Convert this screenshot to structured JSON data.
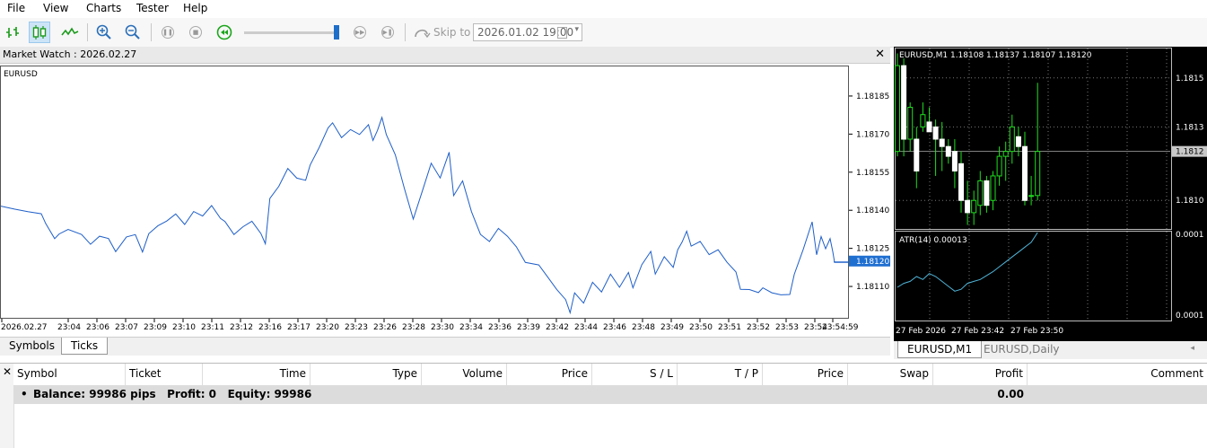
{
  "menu": [
    "File",
    "View",
    "Charts",
    "Tester",
    "Help"
  ],
  "toolbar": {
    "skip_label": "Skip to",
    "skip_date": "2026.01.02 19:00",
    "speed_fraction": 0.95
  },
  "market_watch": {
    "title": "Market Watch : 2026.02.27",
    "tabs": [
      "Symbols",
      "Ticks"
    ],
    "active_tab": "Ticks"
  },
  "chart_data": [
    {
      "type": "line",
      "symbol": "EURUSD",
      "x_ticks": [
        "2026.02.27",
        "23:04",
        "23:06",
        "23:07",
        "23:09",
        "23:10",
        "23:11",
        "23:12",
        "23:16",
        "23:17",
        "23:20",
        "23:23",
        "23:26",
        "23:28",
        "23:30",
        "23:34",
        "23:36",
        "23:39",
        "23:42",
        "23:44",
        "23:46",
        "23:48",
        "23:49",
        "23:50",
        "23:51",
        "23:52",
        "23:53",
        "23:54",
        "23:54:59"
      ],
      "y_ticks": [
        "1.18185",
        "1.18170",
        "1.18155",
        "1.18140",
        "1.18125",
        "1.18110"
      ],
      "ylim": [
        1.18098,
        1.18197
      ],
      "current_price": "1.18120",
      "series": [
        {
          "color": "#1f5fc8",
          "x": [
            0,
            15,
            30,
            45,
            50,
            60,
            65,
            75,
            90,
            100,
            110,
            120,
            128,
            140,
            150,
            158,
            165,
            175,
            185,
            195,
            205,
            215,
            225,
            235,
            245,
            250,
            260,
            270,
            280,
            290,
            295,
            300,
            310,
            320,
            330,
            340,
            345,
            355,
            365,
            370,
            380,
            390,
            400,
            410,
            415,
            420,
            425,
            430,
            440,
            450,
            460,
            470,
            480,
            490,
            500,
            505,
            515,
            525,
            535,
            545,
            555,
            565,
            575,
            585,
            600,
            610,
            620,
            630,
            635,
            640,
            650,
            660,
            670,
            680,
            690,
            700,
            705,
            715,
            725,
            730,
            740,
            750,
            755,
            760,
            765,
            770,
            780,
            790,
            800,
            810,
            820,
            825,
            835,
            845,
            850,
            860,
            870,
            880,
            885,
            895,
            905,
            910,
            915,
            920,
            925,
            928,
            930,
            945
          ],
          "values": [
            1.18142,
            1.18141,
            1.1814,
            1.18139,
            1.18135,
            1.18129,
            1.18131,
            1.18133,
            1.18131,
            1.18127,
            1.1813,
            1.18129,
            1.18124,
            1.1813,
            1.18131,
            1.18124,
            1.18131,
            1.18134,
            1.18136,
            1.18139,
            1.18135,
            1.1814,
            1.18138,
            1.18142,
            1.18137,
            1.18136,
            1.18131,
            1.18134,
            1.18136,
            1.18131,
            1.18127,
            1.18145,
            1.1815,
            1.18157,
            1.18153,
            1.18152,
            1.18158,
            1.18165,
            1.18173,
            1.18175,
            1.18169,
            1.18172,
            1.1817,
            1.18174,
            1.18168,
            1.18172,
            1.18177,
            1.1817,
            1.18162,
            1.18149,
            1.18137,
            1.18148,
            1.18159,
            1.18153,
            1.18163,
            1.18146,
            1.18152,
            1.1814,
            1.18131,
            1.18128,
            1.18133,
            1.1813,
            1.18126,
            1.1812,
            1.18119,
            1.18114,
            1.18109,
            1.18105,
            1.181,
            1.18108,
            1.18104,
            1.18112,
            1.18108,
            1.18115,
            1.1811,
            1.18116,
            1.1811,
            1.18119,
            1.18124,
            1.18115,
            1.18122,
            1.18118,
            1.18125,
            1.18128,
            1.18132,
            1.18126,
            1.18128,
            1.18123,
            1.18125,
            1.1812,
            1.18116,
            1.18109,
            1.18109,
            1.18108,
            1.1811,
            1.18108,
            1.18107,
            1.18107,
            1.18115,
            1.18125,
            1.18136,
            1.18123,
            1.1813,
            1.18125,
            1.18129,
            1.18124,
            1.1812,
            1.1812
          ]
        }
      ]
    },
    {
      "type": "candlestick",
      "title": "EURUSD,M1  1.18108 1.18137 1.18107 1.18120",
      "y_ticks": [
        "1.1815",
        "1.1813",
        "1.1812",
        "1.1810"
      ],
      "ylim": [
        1.18088,
        1.18162
      ],
      "current_price": "1.1812",
      "candles": [
        {
          "o": 1.1812,
          "h": 1.1816,
          "l": 1.18118,
          "c": 1.18155
        },
        {
          "o": 1.18155,
          "h": 1.18158,
          "l": 1.18118,
          "c": 1.18125
        },
        {
          "o": 1.18125,
          "h": 1.1814,
          "l": 1.1812,
          "c": 1.18138
        },
        {
          "o": 1.18125,
          "h": 1.1813,
          "l": 1.18105,
          "c": 1.18112
        },
        {
          "o": 1.1813,
          "h": 1.1814,
          "l": 1.18128,
          "c": 1.18135
        },
        {
          "o": 1.18132,
          "h": 1.18138,
          "l": 1.18128,
          "c": 1.18128
        },
        {
          "o": 1.1813,
          "h": 1.18133,
          "l": 1.1811,
          "c": 1.18125
        },
        {
          "o": 1.18125,
          "h": 1.18132,
          "l": 1.18112,
          "c": 1.18122
        },
        {
          "o": 1.18122,
          "h": 1.18125,
          "l": 1.18115,
          "c": 1.18118
        },
        {
          "o": 1.1812,
          "h": 1.18125,
          "l": 1.18105,
          "c": 1.18112
        },
        {
          "o": 1.18115,
          "h": 1.1812,
          "l": 1.18095,
          "c": 1.181
        },
        {
          "o": 1.181,
          "h": 1.18108,
          "l": 1.1809,
          "c": 1.18095
        },
        {
          "o": 1.18095,
          "h": 1.18104,
          "l": 1.1809,
          "c": 1.181
        },
        {
          "o": 1.18098,
          "h": 1.18112,
          "l": 1.18094,
          "c": 1.18108
        },
        {
          "o": 1.18108,
          "h": 1.1811,
          "l": 1.18095,
          "c": 1.18098
        },
        {
          "o": 1.181,
          "h": 1.18112,
          "l": 1.18096,
          "c": 1.1811
        },
        {
          "o": 1.1811,
          "h": 1.18122,
          "l": 1.18106,
          "c": 1.18118
        },
        {
          "o": 1.18118,
          "h": 1.18124,
          "l": 1.18108,
          "c": 1.1812
        },
        {
          "o": 1.1812,
          "h": 1.18135,
          "l": 1.18115,
          "c": 1.1813
        },
        {
          "o": 1.18126,
          "h": 1.1813,
          "l": 1.18118,
          "c": 1.18122
        },
        {
          "o": 1.18122,
          "h": 1.18128,
          "l": 1.18098,
          "c": 1.181
        },
        {
          "o": 1.18102,
          "h": 1.1811,
          "l": 1.18098,
          "c": 1.18102
        },
        {
          "o": 1.18102,
          "h": 1.18148,
          "l": 1.181,
          "c": 1.1812
        }
      ]
    },
    {
      "type": "line",
      "title": "ATR(14) 0.00013",
      "y_ticks": [
        "0.0001",
        "0.0001"
      ],
      "ylim": [
        4e-05,
        0.00013
      ],
      "values": [
        7.4e-05,
        7.8e-05,
        8e-05,
        8.5e-05,
        8.2e-05,
        8.8e-05,
        8.5e-05,
        8e-05,
        7.5e-05,
        7e-05,
        7.2e-05,
        7.8e-05,
        8e-05,
        8.2e-05,
        8.6e-05,
        9e-05,
        9.5e-05,
        0.0001,
        0.000105,
        0.00011,
        0.000115,
        0.00012,
        0.00013
      ]
    }
  ],
  "right_chart": {
    "x_ticks": [
      "27 Feb 2026",
      "27 Feb 23:42",
      "27 Feb 23:50"
    ],
    "tabs": [
      "EURUSD,M1",
      "EURUSD,Daily"
    ],
    "active_tab": "EURUSD,M1"
  },
  "terminal": {
    "columns": [
      "Symbol",
      "Ticket",
      "Time",
      "Type",
      "Volume",
      "Price",
      "S / L",
      "T / P",
      "Price",
      "Swap",
      "Profit",
      "Comment"
    ],
    "balance_text": "Balance: 99986 pips   Profit: 0   Equity: 99986",
    "profit_total": "0.00"
  }
}
